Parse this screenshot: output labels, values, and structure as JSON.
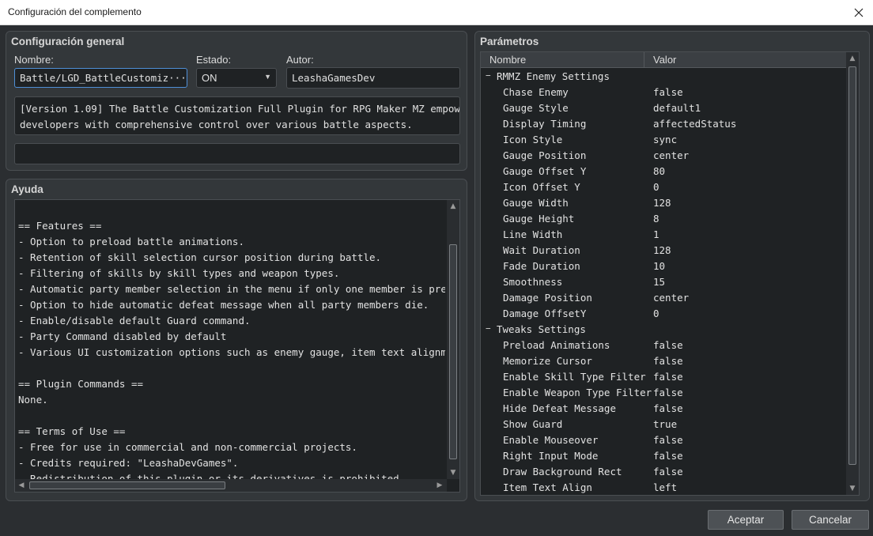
{
  "window": {
    "title": "Configuración del complemento"
  },
  "general": {
    "title": "Configuración general",
    "name_label": "Nombre:",
    "name_value": "Battle/LGD_BattleCustomiz···",
    "status_label": "Estado:",
    "status_value": "ON",
    "author_label": "Autor:",
    "author_value": "LeashaGamesDev",
    "description": "[Version 1.09] The Battle Customization Full Plugin for RPG Maker MZ empowers\ndevelopers with comprehensive control over various battle aspects."
  },
  "help": {
    "title": "Ayuda",
    "text": "== Features ==\n- Option to preload battle animations.\n- Retention of skill selection cursor position during battle.\n- Filtering of skills by skill types and weapon types.\n- Automatic party member selection in the menu if only one member is present.\n- Option to hide automatic defeat message when all party members die.\n- Enable/disable default Guard command.\n- Party Command disabled by default\n- Various UI customization options such as enemy gauge, item text alignment and more.\n\n== Plugin Commands ==\nNone.\n\n== Terms of Use ==\n- Free for use in commercial and non-commercial projects.\n- Credits required: \"LeashaDevGames\".\n- Redistribution of this plugin or its derivatives is prohibited."
  },
  "params": {
    "title": "Parámetros",
    "col_name": "Nombre",
    "col_value": "Valor",
    "groups": [
      {
        "label": "RMMZ Enemy Settings",
        "items": [
          {
            "name": "Chase Enemy",
            "value": "false"
          },
          {
            "name": "Gauge Style",
            "value": "default1"
          },
          {
            "name": "Display Timing",
            "value": "affectedStatus"
          },
          {
            "name": "Icon Style",
            "value": "sync"
          },
          {
            "name": "Gauge Position",
            "value": "center"
          },
          {
            "name": "Gauge Offset Y",
            "value": "80"
          },
          {
            "name": "Icon Offset Y",
            "value": "0"
          },
          {
            "name": "Gauge Width",
            "value": "128"
          },
          {
            "name": "Gauge Height",
            "value": "8"
          },
          {
            "name": "Line Width",
            "value": "1"
          },
          {
            "name": "Wait Duration",
            "value": "128"
          },
          {
            "name": "Fade Duration",
            "value": "10"
          },
          {
            "name": "Smoothness",
            "value": "15"
          },
          {
            "name": "Damage Position",
            "value": "center"
          },
          {
            "name": "Damage OffsetY",
            "value": "0"
          }
        ]
      },
      {
        "label": "Tweaks Settings",
        "items": [
          {
            "name": "Preload Animations",
            "value": "false"
          },
          {
            "name": "Memorize Cursor",
            "value": "false"
          },
          {
            "name": "Enable Skill Type Filter",
            "value": "false"
          },
          {
            "name": "Enable Weapon Type Filter",
            "value": "false"
          },
          {
            "name": "Hide Defeat Message",
            "value": "false"
          },
          {
            "name": "Show Guard",
            "value": "true"
          },
          {
            "name": "Enable Mouseover",
            "value": "false"
          },
          {
            "name": "Right Input Mode",
            "value": "false"
          },
          {
            "name": "Draw Background Rect",
            "value": "false"
          },
          {
            "name": "Item Text Align",
            "value": "left"
          }
        ]
      }
    ]
  },
  "buttons": {
    "accept": "Aceptar",
    "cancel": "Cancelar"
  }
}
